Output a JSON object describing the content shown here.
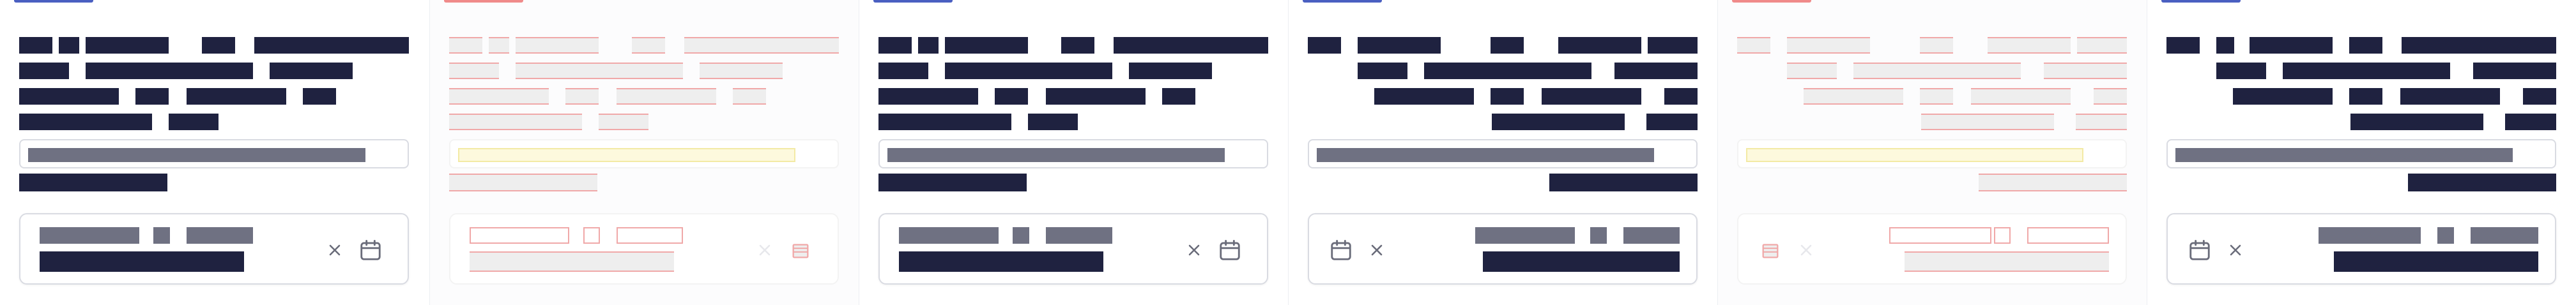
{
  "colors": {
    "ink": "#1f2240",
    "muted": "#6f7182",
    "border": "#d9dbe2",
    "accent_blue": "#4a5fc1",
    "accent_red": "#f08a8a",
    "placeholder_red": "#f0a8a8",
    "placeholder_yellow": "#fdf9dd"
  },
  "panels": [
    {
      "id": "ltr-1",
      "direction": "ltr",
      "variant": "solid",
      "accent": "blue"
    },
    {
      "id": "ltr-2",
      "direction": "ltr",
      "variant": "ghost",
      "accent": "red"
    },
    {
      "id": "ltr-3",
      "direction": "ltr",
      "variant": "solid",
      "accent": "blue"
    },
    {
      "id": "rtl-1",
      "direction": "rtl",
      "variant": "solid",
      "accent": "blue"
    },
    {
      "id": "rtl-2",
      "direction": "rtl",
      "variant": "ghost",
      "accent": "red"
    },
    {
      "id": "rtl-3",
      "direction": "rtl",
      "variant": "solid",
      "accent": "blue"
    }
  ],
  "icons": {
    "clear": "close-icon",
    "calendar": "calendar-icon"
  }
}
